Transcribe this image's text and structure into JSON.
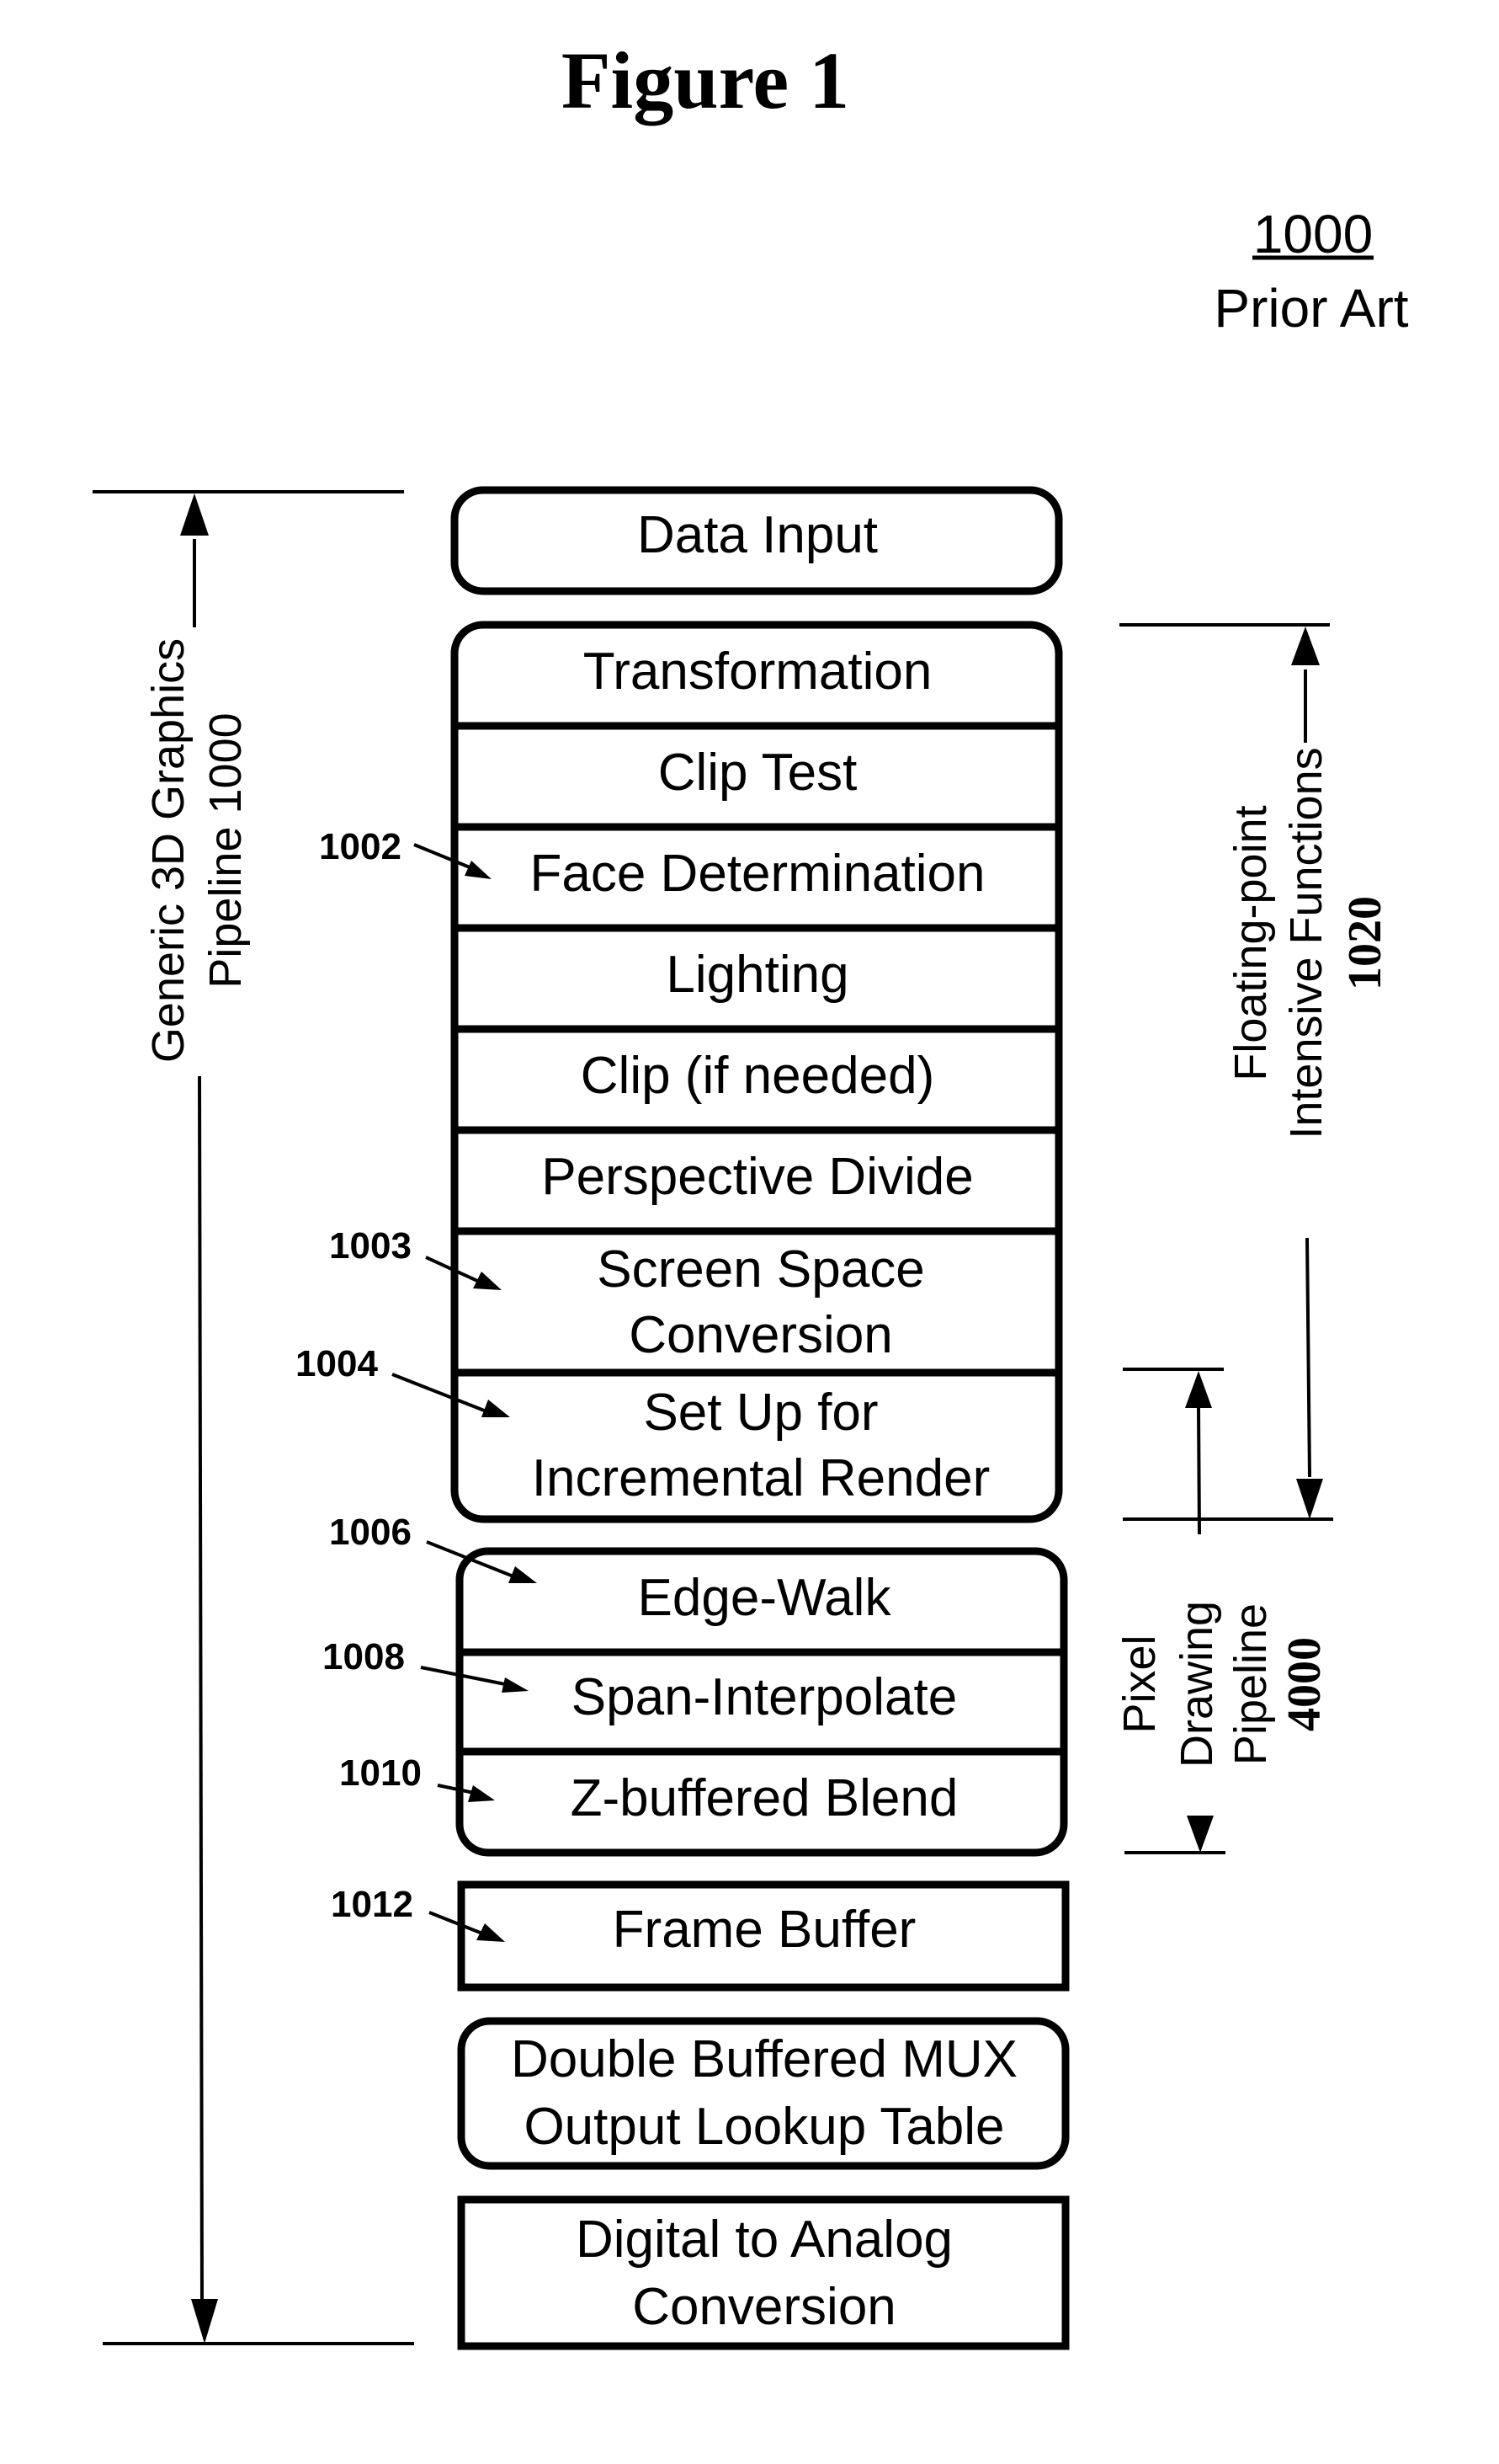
{
  "figure": {
    "title": "Figure 1",
    "number": "1000",
    "caption": "Prior Art"
  },
  "stages": [
    {
      "id": "data-input",
      "lines": [
        "Data Input"
      ],
      "ref": ""
    },
    {
      "id": "transformation",
      "lines": [
        "Transformation"
      ],
      "ref": ""
    },
    {
      "id": "clip-test",
      "lines": [
        "Clip Test"
      ],
      "ref": ""
    },
    {
      "id": "face-determination",
      "lines": [
        "Face Determination"
      ],
      "ref": "1002"
    },
    {
      "id": "lighting",
      "lines": [
        "Lighting"
      ],
      "ref": ""
    },
    {
      "id": "clip-if-needed",
      "lines": [
        "Clip (if needed)"
      ],
      "ref": ""
    },
    {
      "id": "perspective-divide",
      "lines": [
        "Perspective Divide"
      ],
      "ref": ""
    },
    {
      "id": "screen-space-conversion",
      "lines": [
        "Screen Space",
        "Conversion"
      ],
      "ref": "1003"
    },
    {
      "id": "set-up-incremental-render",
      "lines": [
        "Set Up for",
        "Incremental Render"
      ],
      "ref": "1004"
    },
    {
      "id": "edge-walk",
      "lines": [
        "Edge-Walk"
      ],
      "ref": "1006"
    },
    {
      "id": "span-interpolate",
      "lines": [
        "Span-Interpolate"
      ],
      "ref": "1008"
    },
    {
      "id": "z-buffered-blend",
      "lines": [
        "Z-buffered Blend"
      ],
      "ref": "1010"
    },
    {
      "id": "frame-buffer",
      "lines": [
        "Frame Buffer"
      ],
      "ref": "1012"
    },
    {
      "id": "double-buffered-mux",
      "lines": [
        "Double Buffered MUX",
        "Output Lookup Table"
      ],
      "ref": ""
    },
    {
      "id": "digital-to-analog",
      "lines": [
        "Digital to Analog",
        "Conversion"
      ],
      "ref": ""
    }
  ],
  "brackets": {
    "pipeline": {
      "lines": [
        "Generic 3D Graphics",
        "Pipeline 1000"
      ]
    },
    "floating_point": {
      "lines": [
        "Floating-point",
        "Intensive Functions"
      ],
      "number": "1020"
    },
    "pixel_drawing": {
      "lines": [
        "Pixel",
        "Drawing",
        "Pipeline"
      ],
      "number": "4000"
    }
  }
}
